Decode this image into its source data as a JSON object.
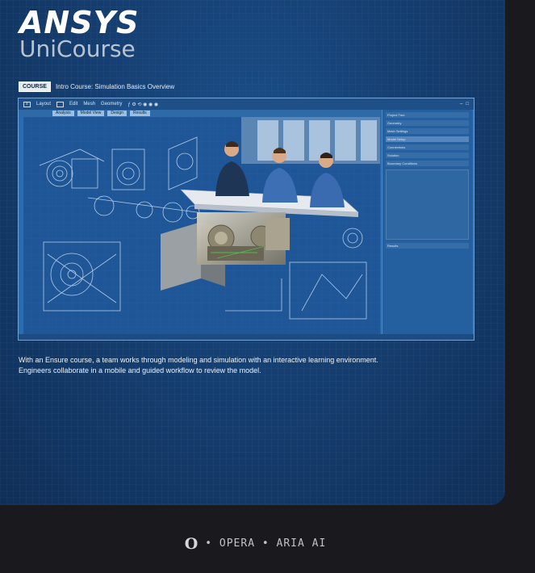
{
  "brand": {
    "name": "ANSYS",
    "product": "UniCourse"
  },
  "tag": {
    "label": "COURSE",
    "text": "Intro Course: Simulation Basics Overview"
  },
  "app_window": {
    "toolbar_items": [
      "Layout",
      "Edit",
      "Mesh",
      "Geometry"
    ],
    "tabs": [
      "Analysis",
      "Model View",
      "Design",
      "Results"
    ],
    "panel_rows": [
      "Project Tree",
      "Geometry",
      "Mesh Settings",
      "Model Setup",
      "Connections",
      "Solution",
      "Boundary Conditions",
      "Results"
    ]
  },
  "caption": {
    "line1": "With an Ensure course, a team works through modeling and simulation with an interactive learning environment.",
    "line2": "Engineers collaborate in a mobile and guided workflow to review the model."
  },
  "footer": {
    "icon": "opera-icon",
    "text": "• OPERA • ARIA AI"
  },
  "colors": {
    "card": "#153f72",
    "accent": "#2a6cb0",
    "footer_bg": "#1a1a1e"
  }
}
